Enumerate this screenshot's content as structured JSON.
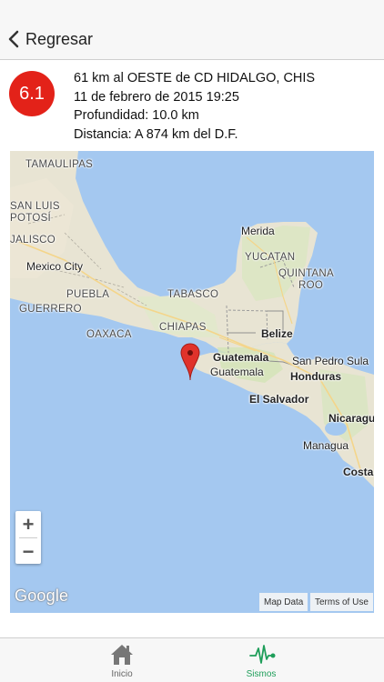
{
  "nav": {
    "back_label": "Regresar"
  },
  "quake": {
    "magnitude": "6.1",
    "location": "61 km al OESTE de CD HIDALGO, CHIS",
    "datetime": "11 de febrero de 2015 19:25",
    "depth": "Profundidad: 10.0 km",
    "distance": "Distancia: A 874 km del D.F."
  },
  "map": {
    "labels": {
      "tamaulipas": "TAMAULIPAS",
      "san_luis_potosi_1": "SAN LUIS",
      "san_luis_potosi_2": "POTOSÍ",
      "jalisco": "JALISCO",
      "mexico_city": "Mexico City",
      "puebla": "PUEBLA",
      "guerrero": "GUERRERO",
      "oaxaca": "OAXACA",
      "tabasco": "TABASCO",
      "chiapas": "CHIAPAS",
      "merida": "Merida",
      "yucatan": "YUCATAN",
      "quintana_roo_1": "QUINTANA",
      "quintana_roo_2": "ROO",
      "belize": "Belize",
      "guatemala_country": "Guatemala",
      "guatemala_city": "Guatemala",
      "san_pedro_sula": "San Pedro Sula",
      "honduras": "Honduras",
      "el_salvador": "El Salvador",
      "nicaragua": "Nicaragua",
      "managua": "Managua",
      "costa": "Costa"
    },
    "zoom_in": "+",
    "zoom_out": "−",
    "google": "Google",
    "map_data": "Map Data",
    "terms": "Terms of Use"
  },
  "tabs": [
    {
      "label": "Inicio",
      "icon": "home-icon"
    },
    {
      "label": "Sismos",
      "icon": "seismograph-icon"
    }
  ],
  "colors": {
    "magnitude_badge": "#e32219",
    "active_tab": "#1f9e5a",
    "map_marker": "#e0322b",
    "water": "#a4c8f0",
    "land": "#e8e4d3"
  }
}
